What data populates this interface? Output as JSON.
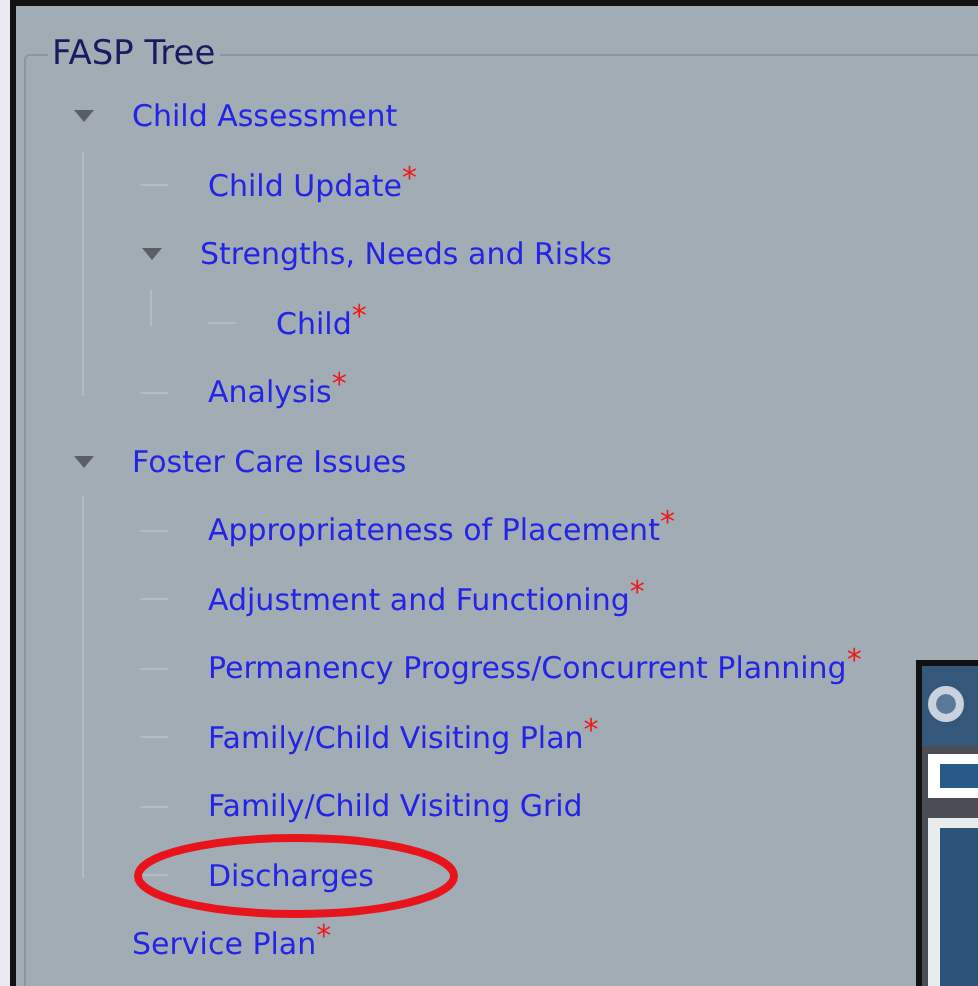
{
  "panel": {
    "title": "FASP Tree"
  },
  "tree": [
    {
      "label": "Child Assessment",
      "expanded": true,
      "circled": false,
      "children": [
        {
          "label": "Child Update",
          "required_mark": "*",
          "circled": false
        },
        {
          "label": "Strengths, Needs and Risks",
          "expanded": true,
          "circled": false,
          "children": [
            {
              "label": "Child",
              "required_mark": "*",
              "circled": false
            }
          ]
        },
        {
          "label": "Analysis",
          "required_mark": "*",
          "circled": false
        }
      ]
    },
    {
      "label": "Foster Care Issues",
      "expanded": true,
      "circled": false,
      "children": [
        {
          "label": "Appropriateness of Placement",
          "required_mark": "*",
          "circled": false
        },
        {
          "label": "Adjustment and Functioning",
          "required_mark": "*",
          "circled": false
        },
        {
          "label": "Permanency Progress/Concurrent Planning",
          "required_mark": "*",
          "circled": false
        },
        {
          "label": "Family/Child Visiting Plan",
          "required_mark": "*",
          "circled": false
        },
        {
          "label": "Family/Child Visiting Grid",
          "circled": false
        },
        {
          "label": "Discharges",
          "circled": true
        }
      ]
    },
    {
      "label": "Service Plan",
      "required_mark": "*",
      "circled": false
    }
  ]
}
